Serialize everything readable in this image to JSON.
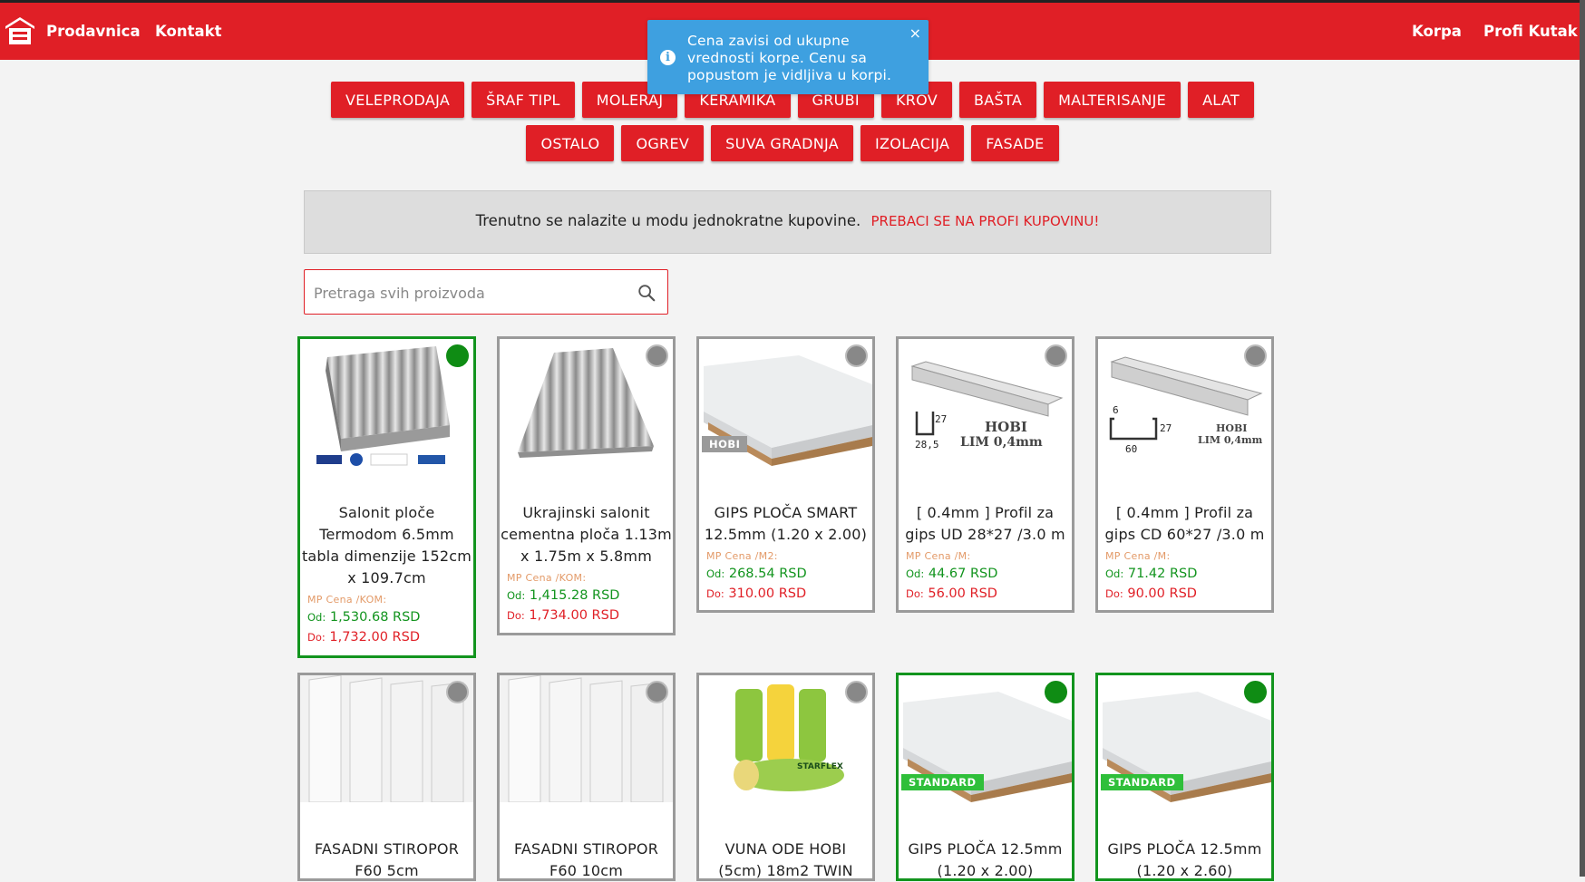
{
  "nav": {
    "shop": "Prodavnica",
    "contact": "Kontakt",
    "cart": "Korpa",
    "profi": "Profi Kutak"
  },
  "toast": {
    "message": "Cena zavisi od ukupne vrednosti korpe. Cenu sa popustom je vidljiva u korpi.",
    "close": "×",
    "info_glyph": "i"
  },
  "categories": {
    "row1": [
      "VELEPRODAJA",
      "ŠRAF TIPL",
      "MOLERAJ",
      "KERAMIKA",
      "GRUBI",
      "KROV",
      "BAŠTA",
      "MALTERISANJE",
      "ALAT"
    ],
    "row2": [
      "OSTALO",
      "OGREV",
      "SUVA GRADNJA",
      "IZOLACIJA",
      "FASADE"
    ]
  },
  "mode": {
    "text": "Trenutno se nalazite u modu jednokratne kupovine.",
    "link": "PREBACI SE NA PROFI KUPOVINU!"
  },
  "search": {
    "placeholder": "Pretraga svih proizvoda"
  },
  "labels": {
    "od": "Od:",
    "do": "Do:"
  },
  "products": [
    {
      "title_lines": [
        "Salonit ploče",
        "Termodom 6.5mm",
        "tabla dimenzije 152cm",
        "x 109.7cm"
      ],
      "price_label": "MP Cena /KOM:",
      "od": "1,530.68 RSD",
      "do": "1,732.00 RSD",
      "selected": true,
      "image": "corrugated-sheet-stack"
    },
    {
      "title_lines": [
        "Ukrajinski salonit",
        "cementna ploča 1.13m",
        "x 1.75m x 5.8mm"
      ],
      "price_label": "MP Cena /KOM:",
      "od": "1,415.28 RSD",
      "do": "1,734.00 RSD",
      "selected": false,
      "image": "corrugated-sheet"
    },
    {
      "title_lines": [
        "GIPS PLOČA SMART",
        "12.5mm (1.20 x 2.00)"
      ],
      "price_label": "MP Cena /M2:",
      "od": "268.54 RSD",
      "do": "310.00 RSD",
      "selected": false,
      "image": "plasterboard-stack",
      "tag": "HOBI"
    },
    {
      "title_lines": [
        "[ 0.4mm ] Profil za",
        "gips UD 28*27 /3.0 m"
      ],
      "price_label": "MP Cena /M:",
      "od": "44.67 RSD",
      "do": "56.00 RSD",
      "selected": false,
      "image": "profile-ud",
      "caption1": "HOBI",
      "caption2": "LIM 0,4mm",
      "dim_a": "28,5",
      "dim_b": "27"
    },
    {
      "title_lines": [
        "[ 0.4mm ] Profil za",
        "gips CD 60*27 /3.0 m"
      ],
      "price_label": "MP Cena /M:",
      "od": "71.42 RSD",
      "do": "90.00 RSD",
      "selected": false,
      "image": "profile-cd",
      "caption1": "HOBI",
      "caption2": "LIM 0,4mm",
      "dim_a": "60",
      "dim_b": "27",
      "dim_c": "6"
    },
    {
      "title_lines": [
        "FASADNI STIROPOR",
        "F60 5cm"
      ],
      "selected": false,
      "image": "styrofoam-boards"
    },
    {
      "title_lines": [
        "FASADNI STIROPOR",
        "F60 10cm"
      ],
      "selected": false,
      "image": "styrofoam-boards"
    },
    {
      "title_lines": [
        "VUNA ODE HOBI",
        "(5cm) 18m2 TWIN"
      ],
      "selected": false,
      "image": "mineral-wool-rolls",
      "brand": "STARFLEX"
    },
    {
      "title_lines": [
        "GIPS PLOČA 12.5mm",
        "(1.20 x 2.00)"
      ],
      "selected": true,
      "image": "plasterboard-stack",
      "tag": "STANDARD"
    },
    {
      "title_lines": [
        "GIPS PLOČA 12.5mm",
        "(1.20 x 2.60)"
      ],
      "selected": true,
      "image": "plasterboard-stack",
      "tag": "STANDARD"
    }
  ],
  "colors": {
    "brand_red": "#e01f26",
    "selected_green": "#12941e",
    "toast_blue": "#3ea0e0",
    "price_label": "#e39a68"
  }
}
